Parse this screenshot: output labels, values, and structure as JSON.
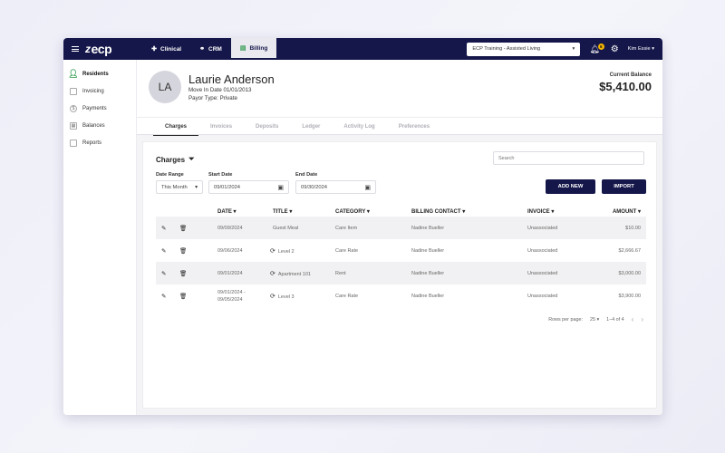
{
  "topbar": {
    "logo": "ecp",
    "nav": [
      {
        "label": "Clinical",
        "icon": "stethoscope-icon"
      },
      {
        "label": "CRM",
        "icon": "network-icon"
      },
      {
        "label": "Billing",
        "icon": "billing-icon",
        "active": true
      }
    ],
    "facility": "ECP Training - Assisted Living",
    "notification_count": "6",
    "user": "Kim Essie"
  },
  "sidebar": {
    "items": [
      {
        "label": "Residents",
        "icon": "person-icon",
        "active": true
      },
      {
        "label": "Invoicing",
        "icon": "invoice-icon"
      },
      {
        "label": "Payments",
        "icon": "dollar-icon"
      },
      {
        "label": "Balances",
        "icon": "calculator-icon"
      },
      {
        "label": "Reports",
        "icon": "clipboard-icon"
      }
    ]
  },
  "resident": {
    "initials": "LA",
    "name": "Laurie Anderson",
    "move_in": "Move In Date 01/01/2013",
    "payor": "Payor Type: Private",
    "balance_label": "Current Balance",
    "balance": "$5,410.00"
  },
  "tabs": [
    "Charges",
    "Invoices",
    "Deposits",
    "Ledger",
    "Activity Log",
    "Preferences"
  ],
  "charges": {
    "title": "Charges",
    "search_placeholder": "Search",
    "date_range_label": "Date Range",
    "date_range_value": "This Month",
    "start_date_label": "Start Date",
    "start_date": "09/01/2024",
    "end_date_label": "End Date",
    "end_date": "09/30/2024",
    "add_new": "ADD NEW",
    "import": "IMPORT",
    "columns": [
      "DATE",
      "TITLE",
      "CATEGORY",
      "BILLING CONTACT",
      "INVOICE",
      "AMOUNT"
    ],
    "rows": [
      {
        "date": "09/09/2024",
        "title": "Guest Meal",
        "recurring": false,
        "category": "Care Item",
        "contact": "Nadine Bueller",
        "invoice": "Unassociated",
        "amount": "$10.00"
      },
      {
        "date": "09/06/2024",
        "title": "Level 2",
        "recurring": true,
        "category": "Care Rate",
        "contact": "Nadine Bueller",
        "invoice": "Unassociated",
        "amount": "$2,666.67"
      },
      {
        "date": "09/01/2024",
        "title": "Apartment 101",
        "recurring": true,
        "category": "Rent",
        "contact": "Nadine Bueller",
        "invoice": "Unassociated",
        "amount": "$3,000.00"
      },
      {
        "date": "09/01/2024 -",
        "date2": "09/05/2024",
        "title": "Level 3",
        "recurring": true,
        "category": "Care Rate",
        "contact": "Nadine Bueller",
        "invoice": "Unassociated",
        "amount": "$3,900.00"
      }
    ],
    "pagination": {
      "rows_label": "Rows per page:",
      "rows_value": "25",
      "range": "1–4 of 4"
    }
  }
}
